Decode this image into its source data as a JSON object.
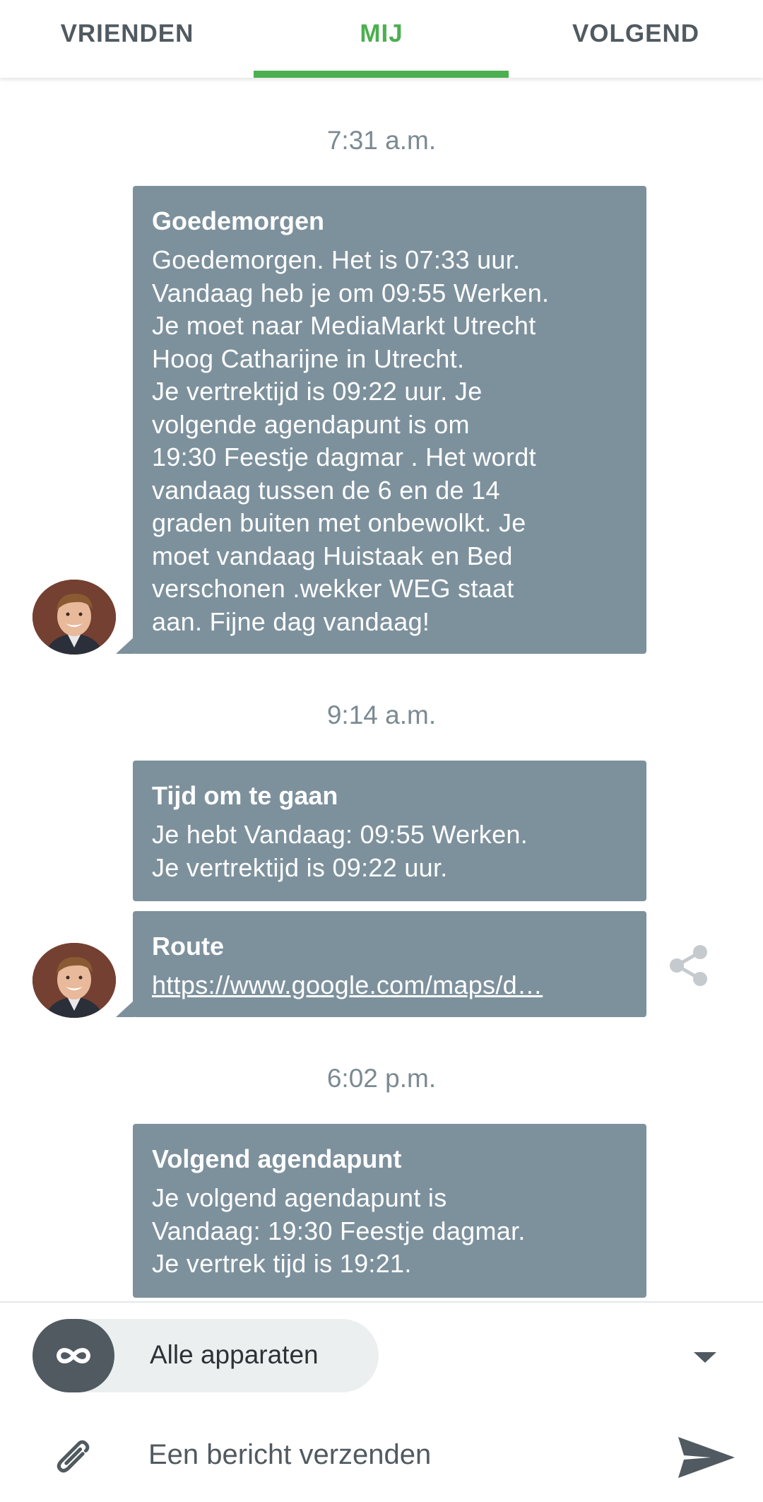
{
  "tabs": [
    {
      "label": "VRIENDEN"
    },
    {
      "label": "MIJ",
      "active": true
    },
    {
      "label": "VOLGEND"
    }
  ],
  "colors": {
    "accent": "#4caf50",
    "bubble": "#7d919d",
    "dark_icon": "#505a60",
    "timestamp": "#7b8a92"
  },
  "messages": [
    {
      "time": "7:31 a.m.",
      "title": "Goedemorgen",
      "body": "Goedemorgen. Het is 07:33 uur.\nVandaag heb je om 09:55 Werken.\nJe moet naar MediaMarkt Utrecht\nHoog Catharijne in Utrecht.\nJe vertrektijd is 09:22 uur. Je\nvolgende agendapunt is om\n19:30 Feestje dagmar . Het wordt\nvandaag tussen de 6 en de 14\ngraden buiten met onbewolkt. Je\nmoet vandaag Huistaak en Bed\nverschonen .wekker WEG staat\naan. Fijne dag vandaag!"
    },
    {
      "time": "9:14 a.m.",
      "title": "Tijd om te gaan",
      "body": "Je hebt Vandaag: 09:55 Werken.\nJe vertrektijd is 09:22 uur."
    },
    {
      "title": "Route",
      "link": "https://www.google.com/maps/d…",
      "share_icon": "share-icon"
    },
    {
      "time": "6:02 p.m.",
      "title": "Volgend agendapunt",
      "body": "Je volgend agendapunt is\nVandaag: 19:30 Feestje dagmar.\nJe vertrek tijd is 19:21."
    }
  ],
  "composer": {
    "device_label": "Alle apparaten",
    "device_icon": "infinity-icon",
    "placeholder": "Een bericht verzenden",
    "attach_icon": "paperclip-icon",
    "send_icon": "send-icon"
  }
}
